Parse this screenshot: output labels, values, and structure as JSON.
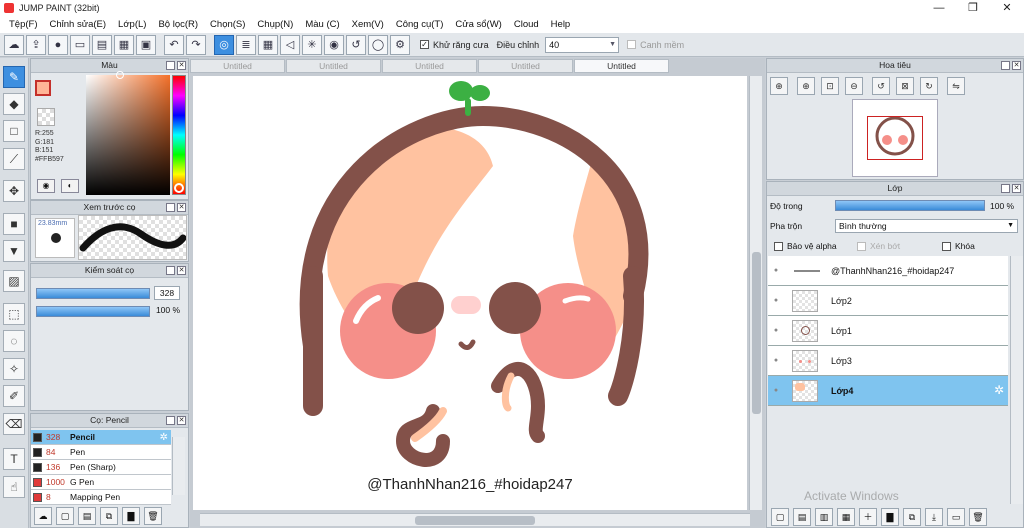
{
  "window": {
    "title": "JUMP PAINT (32bit)",
    "minimize": "—",
    "maximize": "❐",
    "close": "✕"
  },
  "menu": [
    "Tệp(F)",
    "Chỉnh sửa(E)",
    "Lớp(L)",
    "Bộ lọc(R)",
    "Chọn(S)",
    "Chụp(N)",
    "Màu (C)",
    "Xem(V)",
    "Công cụ(T)",
    "Cửa sổ(W)",
    "Cloud",
    "Help"
  ],
  "toolbar": {
    "antialias_label": "Khử răng cưa",
    "antialias_checked": true,
    "adjust_label": "Điều chỉnh",
    "adjust_value": "40",
    "edge_label": "Canh mềm",
    "edge_checked": false
  },
  "color_panel": {
    "title": "Màu",
    "r": "R:255",
    "g": "G:181",
    "b": "B:151",
    "hex": "#FFB597",
    "main_color": "#ffb597",
    "sub_color": "#7a4a41"
  },
  "brush_preview": {
    "title": "Xem trước cọ",
    "size": "23.83mm"
  },
  "brush_control": {
    "title": "Kiểm soát cọ",
    "size_value": "328",
    "opacity_value": "100 %"
  },
  "brush_list": {
    "title": "Cọ: Pencil",
    "items": [
      {
        "size": "328",
        "name": "Pencil",
        "color": "#222222",
        "selected": true
      },
      {
        "size": "84",
        "name": "Pen",
        "color": "#222222",
        "selected": false
      },
      {
        "size": "136",
        "name": "Pen (Sharp)",
        "color": "#222222",
        "selected": false
      },
      {
        "size": "1000",
        "name": "G Pen",
        "color": "#e03a3a",
        "selected": false
      },
      {
        "size": "8",
        "name": "Mapping Pen",
        "color": "#e03a3a",
        "selected": false
      }
    ]
  },
  "tabs": [
    "Untitled",
    "Untitled",
    "Untitled",
    "Untitled",
    "Untitled"
  ],
  "active_tab": 4,
  "canvas": {
    "caption": "@ThanhNhan216_#hoidap247"
  },
  "navigator": {
    "title": "Hoa tiêu"
  },
  "layer_panel": {
    "title": "Lớp",
    "opacity_label": "Độ trong",
    "opacity_value": "100 %",
    "blend_label": "Pha trộn",
    "blend_value": "Bình thường",
    "protect_alpha": "Bảo vệ alpha",
    "clipping": "Xén bớt",
    "lock": "Khóa",
    "layers": [
      {
        "name": "@ThanhNhan216_#hoidap247",
        "selected": false
      },
      {
        "name": "Lớp2",
        "selected": false
      },
      {
        "name": "Lớp1",
        "selected": false
      },
      {
        "name": "Lớp3",
        "selected": false
      },
      {
        "name": "Lớp4",
        "selected": true
      }
    ]
  },
  "watermark": "Activate Windows"
}
